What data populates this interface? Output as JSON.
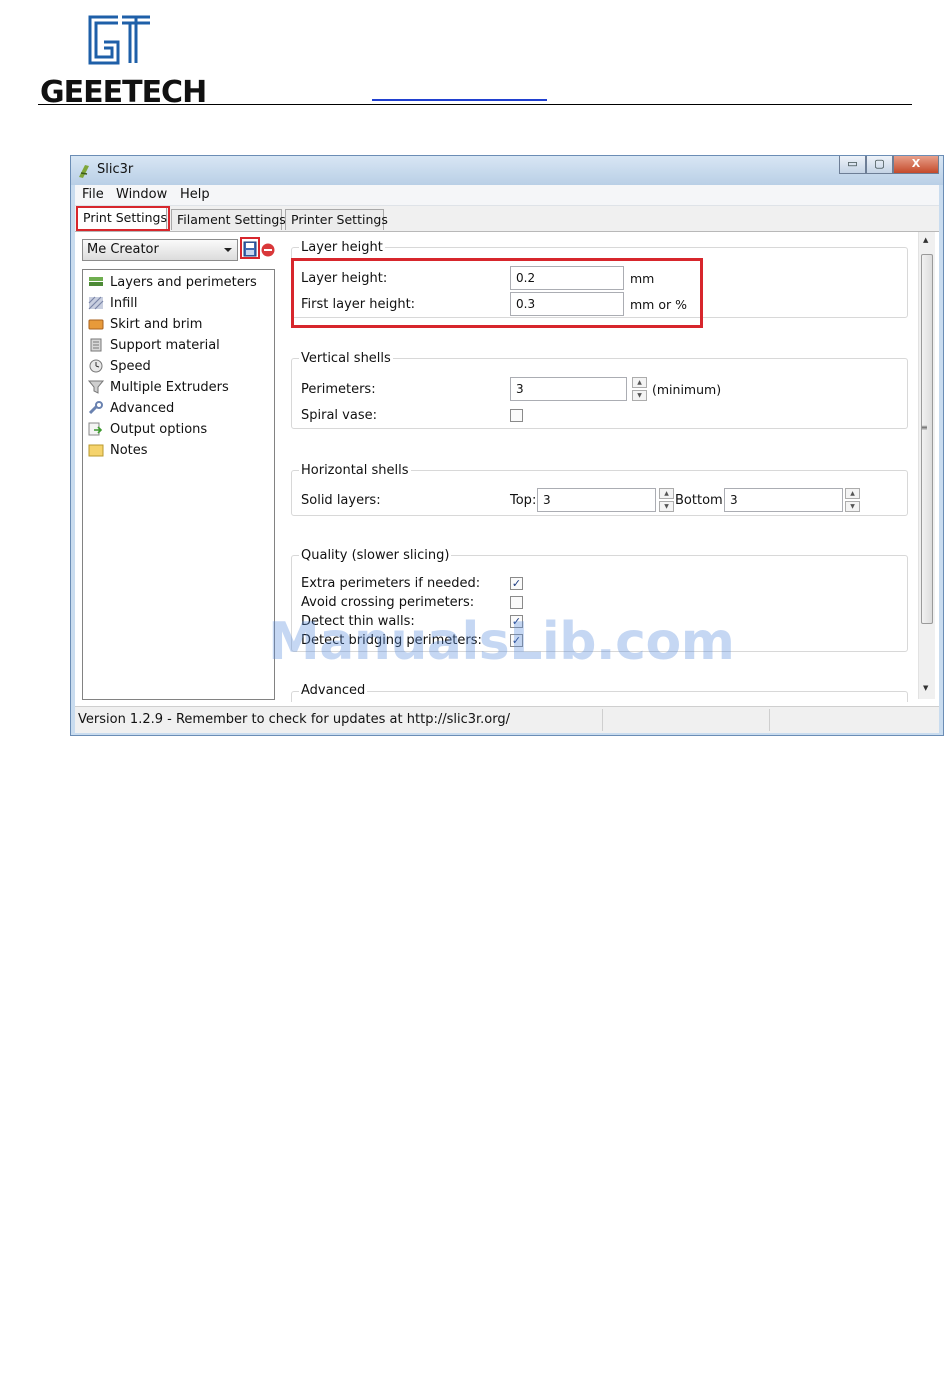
{
  "header": {
    "brand": "GEEETECH",
    "colors": {
      "logo_blue": "#1e5fa8",
      "text": "#111111",
      "highlight": "#d7262c"
    }
  },
  "window": {
    "title": "Slic3r",
    "buttons": {
      "minimize": "▭",
      "maximize": "▢",
      "close": "X"
    }
  },
  "menu": {
    "file": "File",
    "window": "Window",
    "help": "Help"
  },
  "tabs": [
    {
      "label": "Print Settings",
      "active": true
    },
    {
      "label": "Filament Settings",
      "active": false
    },
    {
      "label": "Printer Settings",
      "active": false
    }
  ],
  "preset": {
    "selected": "Me Creator"
  },
  "pages": [
    {
      "label": "Layers and perimeters",
      "icon": "layers-icon"
    },
    {
      "label": "Infill",
      "icon": "infill-icon"
    },
    {
      "label": "Skirt and brim",
      "icon": "skirt-icon"
    },
    {
      "label": "Support material",
      "icon": "support-icon"
    },
    {
      "label": "Speed",
      "icon": "speed-icon"
    },
    {
      "label": "Multiple Extruders",
      "icon": "funnel-icon"
    },
    {
      "label": "Advanced",
      "icon": "wrench-icon"
    },
    {
      "label": "Output options",
      "icon": "output-icon"
    },
    {
      "label": "Notes",
      "icon": "notes-icon"
    }
  ],
  "groups": {
    "layer_height": {
      "title": "Layer height",
      "layer_height_label": "Layer height:",
      "layer_height_value": "0.2",
      "layer_height_unit": "mm",
      "first_layer_label": "First layer height:",
      "first_layer_value": "0.3",
      "first_layer_unit": "mm or %"
    },
    "vertical_shells": {
      "title": "Vertical shells",
      "perimeters_label": "Perimeters:",
      "perimeters_value": "3",
      "perimeters_unit": "(minimum)",
      "spiral_label": "Spiral vase:",
      "spiral_checked": false
    },
    "horizontal_shells": {
      "title": "Horizontal shells",
      "solid_label": "Solid layers:",
      "top_label": "Top:",
      "top_value": "3",
      "bottom_label": "Bottom:",
      "bottom_value": "3"
    },
    "quality": {
      "title": "Quality (slower slicing)",
      "extra_label": "Extra perimeters if needed:",
      "extra_checked": true,
      "avoid_label": "Avoid crossing perimeters:",
      "avoid_checked": false,
      "thin_label": "Detect thin walls:",
      "thin_checked": true,
      "bridge_label": "Detect bridging perimeters:",
      "bridge_checked": true
    },
    "advanced": {
      "title": "Advanced"
    }
  },
  "status": {
    "text": "Version 1.2.9 - Remember to check for updates at http://slic3r.org/"
  },
  "watermark": "ManualsLib.com"
}
